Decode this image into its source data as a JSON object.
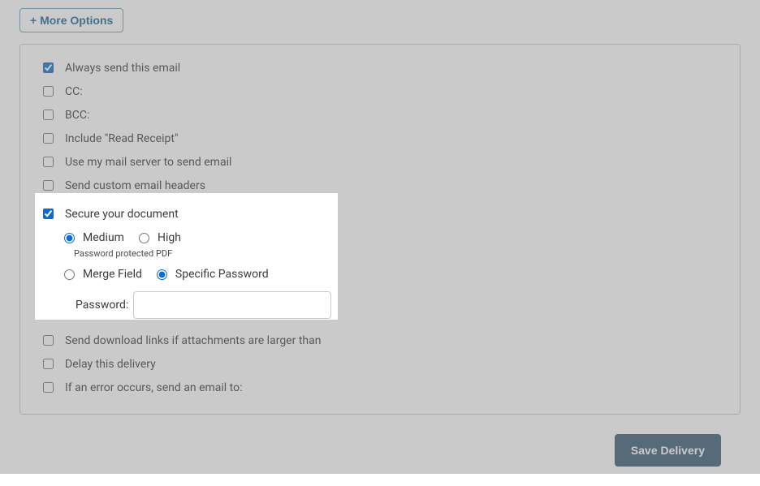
{
  "more_options_label": "+ More Options",
  "options": {
    "always_send": {
      "label": "Always send this email",
      "checked": true
    },
    "cc": {
      "label": "CC:",
      "checked": false
    },
    "bcc": {
      "label": "BCC:",
      "checked": false
    },
    "read_receipt": {
      "label": "Include \"Read Receipt\"",
      "checked": false
    },
    "use_mail_server": {
      "label": "Use my mail server to send email",
      "checked": false
    },
    "custom_headers": {
      "label": "Send custom email headers",
      "checked": false
    },
    "secure_doc": {
      "label": "Secure your document",
      "checked": true
    },
    "download_links": {
      "label": "Send download links if attachments are larger than",
      "checked": false
    },
    "delay": {
      "label": "Delay this delivery",
      "checked": false
    },
    "error_email": {
      "label": "If an error occurs, send an email to:",
      "checked": false
    }
  },
  "secure": {
    "level": {
      "medium": "Medium",
      "high": "High",
      "selected": "medium"
    },
    "hint": "Password protected PDF",
    "source": {
      "merge": "Merge Field",
      "specific": "Specific Password",
      "selected": "specific"
    },
    "password_label": "Password:",
    "password_value": ""
  },
  "save_label": "Save Delivery"
}
